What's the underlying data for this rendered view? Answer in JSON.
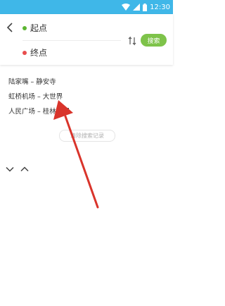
{
  "status_bar": {
    "time": "12:30"
  },
  "search_panel": {
    "start_label": "起点",
    "end_label": "终点",
    "search_button": "搜索",
    "colors": {
      "start_dot": "#5cb531",
      "end_dot": "#e84d4d",
      "search_button": "#7ec34a"
    }
  },
  "history": {
    "items": [
      "陆家嘴 – 静安寺",
      "虹桥机场 – 大世界",
      "人民广场 – 桂林公园"
    ],
    "clear_label": "清除搜索记录"
  },
  "annotation": {
    "color": "#d9342b"
  }
}
